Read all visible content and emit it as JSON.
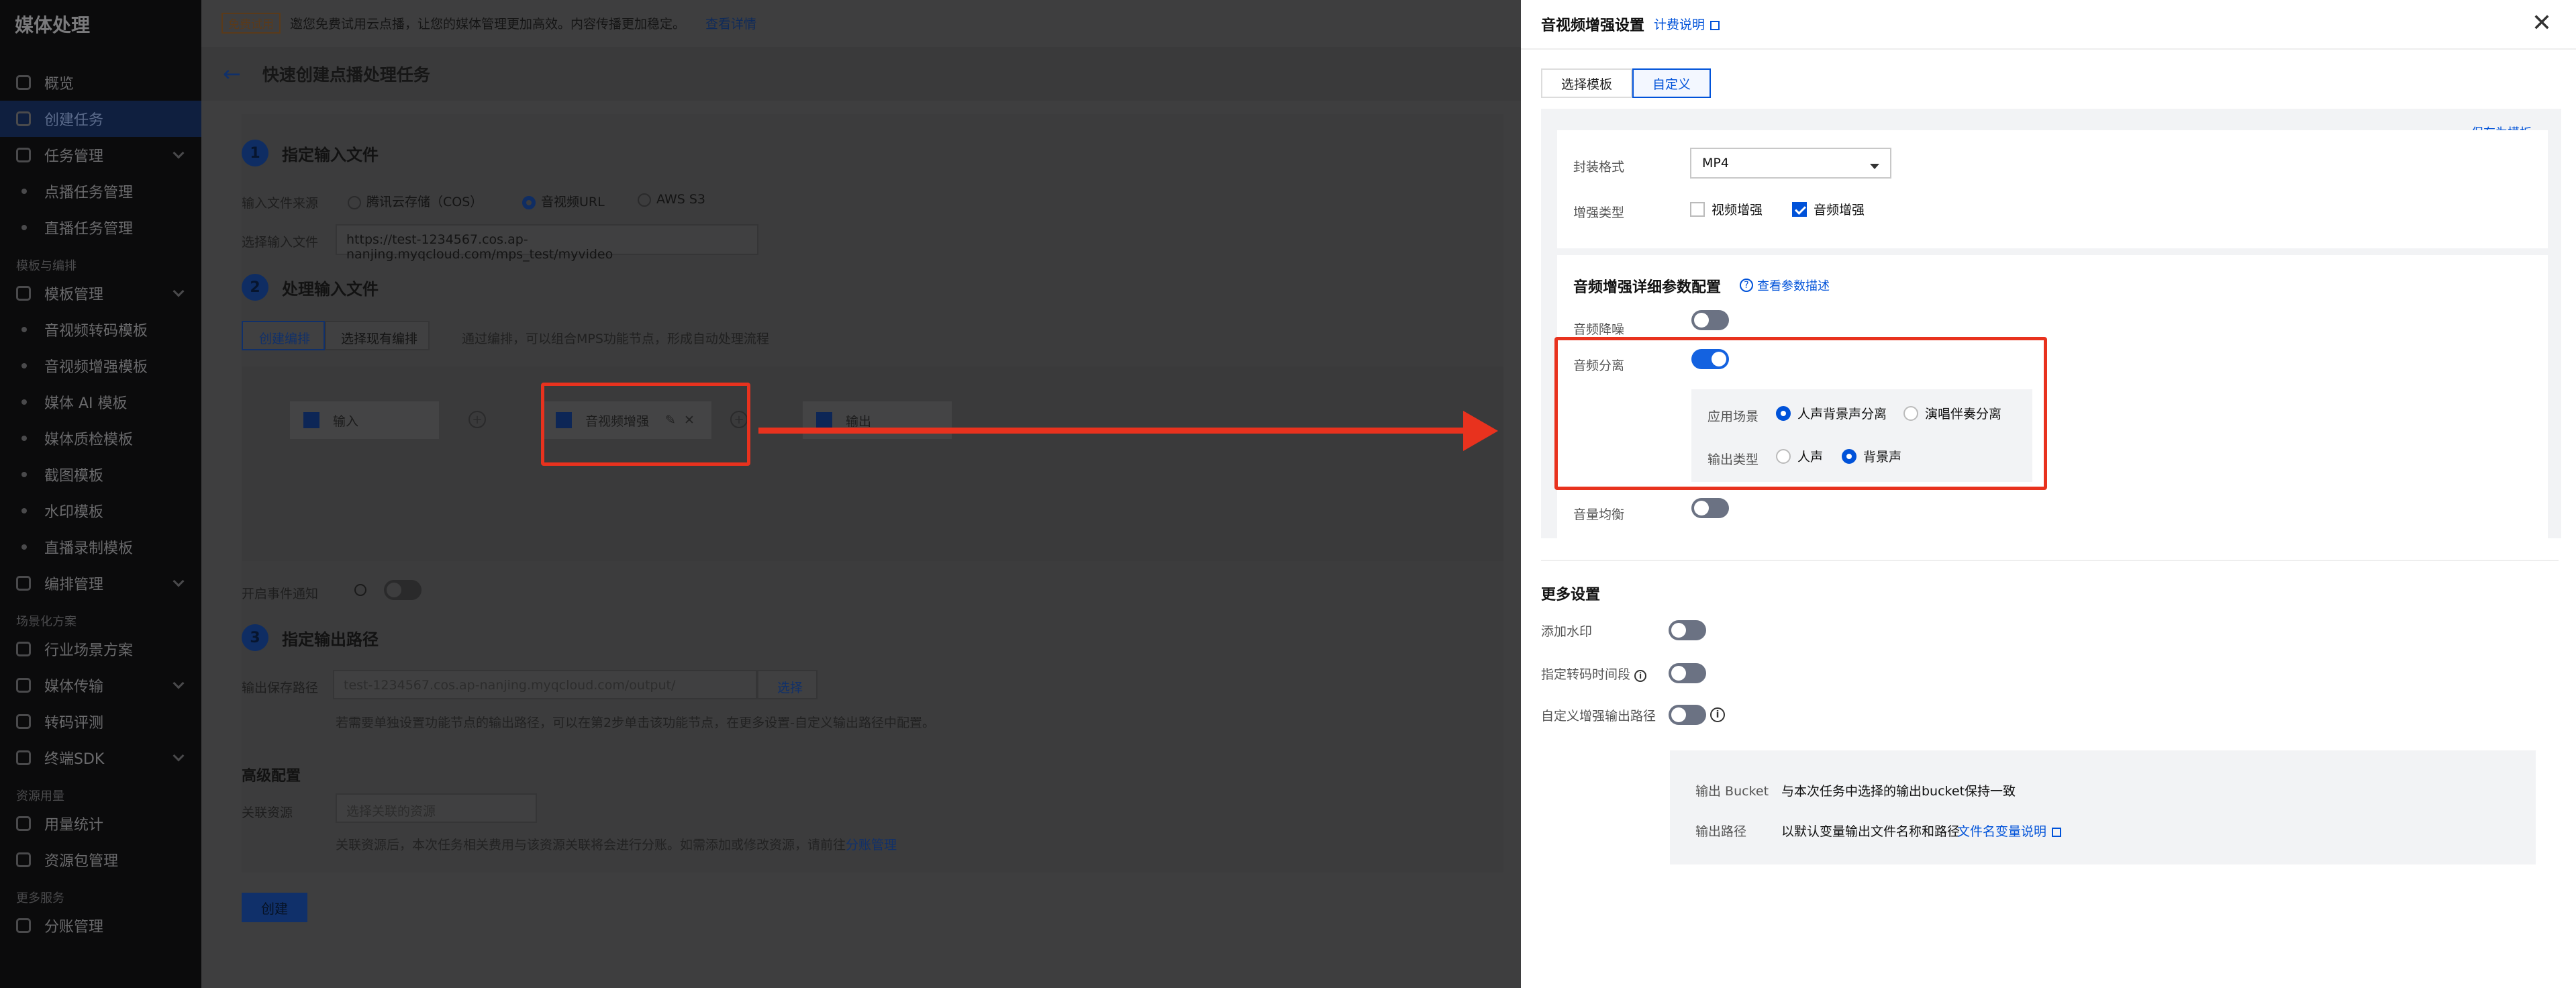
{
  "nav": {
    "title": "媒体处理",
    "items": [
      {
        "label": "概览",
        "type": "item"
      },
      {
        "label": "创建任务",
        "type": "item",
        "active": true
      },
      {
        "label": "任务管理",
        "type": "group"
      },
      {
        "label": "点播任务管理",
        "type": "sub"
      },
      {
        "label": "直播任务管理",
        "type": "sub"
      },
      {
        "label": "模板与编排",
        "type": "heading"
      },
      {
        "label": "模板管理",
        "type": "group"
      },
      {
        "label": "音视频转码模板",
        "type": "sub"
      },
      {
        "label": "音视频增强模板",
        "type": "sub"
      },
      {
        "label": "媒体 AI 模板",
        "type": "sub"
      },
      {
        "label": "媒体质检模板",
        "type": "sub"
      },
      {
        "label": "截图模板",
        "type": "sub"
      },
      {
        "label": "水印模板",
        "type": "sub"
      },
      {
        "label": "直播录制模板",
        "type": "sub"
      },
      {
        "label": "编排管理",
        "type": "group"
      },
      {
        "label": "场景化方案",
        "type": "heading"
      },
      {
        "label": "行业场景方案",
        "type": "item"
      },
      {
        "label": "媒体传输",
        "type": "group"
      },
      {
        "label": "转码评测",
        "type": "item"
      },
      {
        "label": "终端SDK",
        "type": "group"
      },
      {
        "label": "资源用量",
        "type": "heading"
      },
      {
        "label": "用量统计",
        "type": "item"
      },
      {
        "label": "资源包管理",
        "type": "item"
      },
      {
        "label": "更多服务",
        "type": "heading"
      },
      {
        "label": "分账管理",
        "type": "item"
      }
    ]
  },
  "banner": {
    "tag": "免费试用",
    "text": "邀您免费试用云点播，让您的媒体管理更加高效。内容传播更加稳定。",
    "link": "查看详情"
  },
  "main": {
    "page_title": "快速创建点播处理任务",
    "step1": {
      "num": "1",
      "title": "指定输入文件",
      "source_label": "输入文件来源",
      "opt_cos": "腾讯云存储（COS）",
      "opt_url": "音视频URL",
      "opt_s3": "AWS S3",
      "file_label": "选择输入文件",
      "file_value": "https://test-1234567.cos.ap-nanjing.myqcloud.com/mps_test/myvideo"
    },
    "step2": {
      "num": "2",
      "title": "处理输入文件",
      "tab_create": "创建编排",
      "tab_select": "选择现有编排",
      "hint": "通过编排，可以组合MPS功能节点，形成自动处理流程",
      "node_input": "输入",
      "node_enhance": "音视频增强",
      "node_output": "输出"
    },
    "notify_label": "开启事件通知",
    "step3": {
      "num": "3",
      "title": "指定输出路径",
      "path_label": "输出保存路径",
      "path_placeholder": "test-1234567.cos.ap-nanjing.myqcloud.com/output/",
      "select_btn": "选择",
      "hint": "若需要单独设置功能节点的输出路径，可以在第2步单击该功能节点，在更多设置-自定义输出路径中配置。"
    },
    "advanced": {
      "title": "高级配置",
      "resource_label": "关联资源",
      "resource_placeholder": "选择关联的资源",
      "hint": "关联资源后，本次任务相关费用与该资源关联将会进行分账。如需添加或修改资源，请前往",
      "link": "分账管理"
    },
    "create_btn": "创建"
  },
  "drawer": {
    "title": "音视频增强设置",
    "billing_link": "计费说明",
    "tabs": [
      "选择模板",
      "自定义"
    ],
    "save_template": "保存为模板",
    "container_label": "封装格式",
    "container_value": "MP4",
    "enhance_label": "增强类型",
    "video_enhance": "视频增强",
    "audio_enhance": "音频增强",
    "audio_section_title": "音频增强详细参数配置",
    "view_params": "查看参数描述",
    "denoise_label": "音频降噪",
    "separation_label": "音频分离",
    "scene_label": "应用场景",
    "scene_opt1": "人声背景声分离",
    "scene_opt2": "演唱伴奏分离",
    "output_type_label": "输出类型",
    "output_opt1": "人声",
    "output_opt2": "背景声",
    "volume_label": "音量均衡",
    "more_title": "更多设置",
    "watermark_label": "添加水印",
    "time_label": "指定转码时间段",
    "custom_path_label": "自定义增强输出路径",
    "bucket_label": "输出 Bucket",
    "bucket_value": "与本次任务中选择的输出bucket保持一致",
    "path_label": "输出路径",
    "path_value": "以默认变量输出文件名称和路径",
    "var_link": "文件名变量说明"
  },
  "colors": {
    "accent": "#0052d9",
    "highlight": "#e8321e",
    "toggle_on": "#1462e0",
    "toggle_off": "#6b7283"
  }
}
